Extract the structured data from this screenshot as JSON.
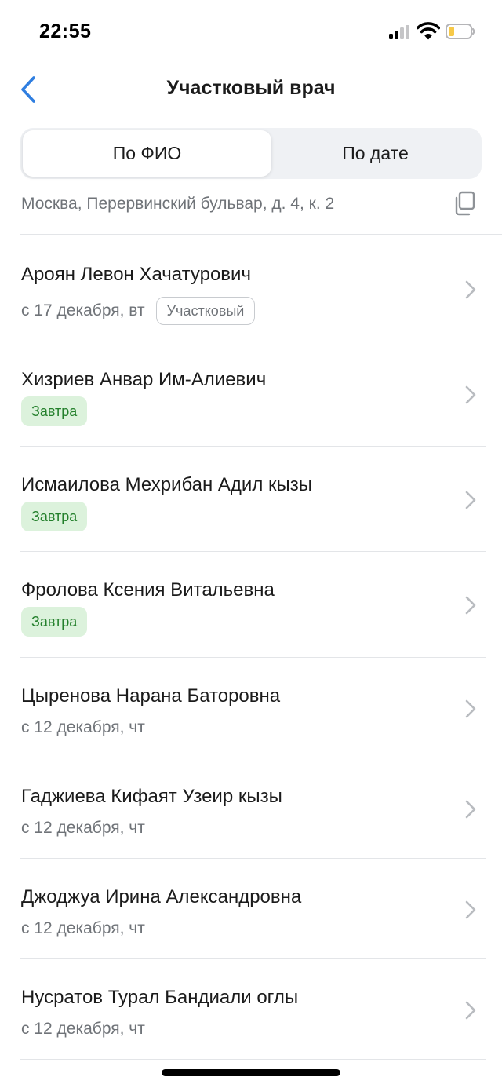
{
  "status_bar": {
    "time": "22:55",
    "icons": [
      "cellular-signal-icon",
      "wifi-icon",
      "battery-low-icon"
    ],
    "battery_color": "#f7c948"
  },
  "nav": {
    "back_icon": "chevron-left-icon",
    "title": "Участковый врач"
  },
  "segments": {
    "by_name": "По ФИО",
    "by_date": "По дате",
    "selected": "by_name"
  },
  "address": {
    "text": "Москва, Перервинский бульвар, д. 4, к. 2",
    "copy_icon": "copy-icon"
  },
  "colors": {
    "accent": "#2f7ee0",
    "badge_green_bg": "#dcf2dc",
    "badge_green_text": "#24802c",
    "secondary_text": "#6f7378"
  },
  "doctors": [
    {
      "name": "Ароян Левон Хачатурович",
      "date": "с 17 декабря, вт",
      "badge": "Участковый"
    },
    {
      "name": "Хизриев Анвар Им-Алиевич",
      "status": "Завтра"
    },
    {
      "name": "Исмаилова Мехрибан Адил кызы",
      "status": "Завтра"
    },
    {
      "name": "Фролова Ксения Витальевна",
      "status": "Завтра"
    },
    {
      "name": "Цыренова Нарана Баторовна",
      "date": "с 12 декабря, чт"
    },
    {
      "name": "Гаджиева Кифаят Узеир кызы",
      "date": "с 12 декабря, чт"
    },
    {
      "name": "Джоджуа Ирина Александровна",
      "date": "с 12 декабря, чт"
    },
    {
      "name": "Нусратов Турал Бандиали оглы",
      "date": "с 12 декабря, чт"
    }
  ]
}
